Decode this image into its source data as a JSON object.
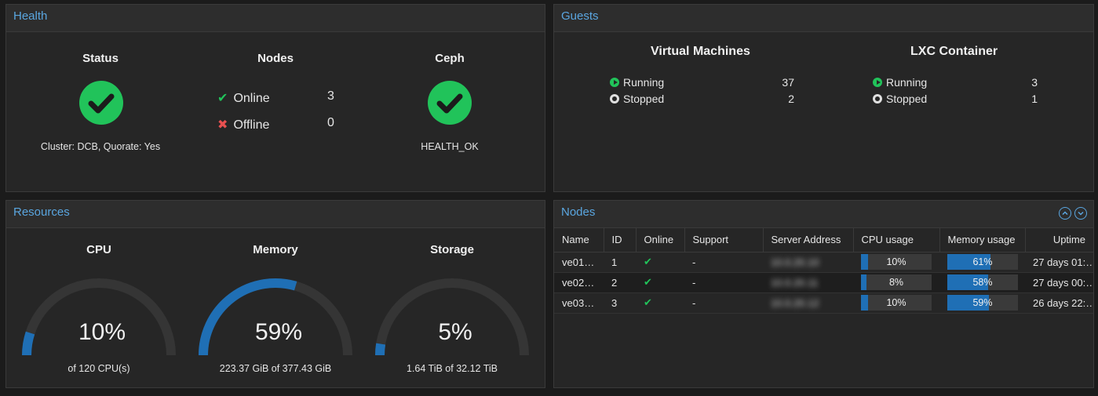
{
  "health": {
    "title": "Health",
    "status": {
      "title": "Status",
      "text": "Cluster: DCB, Quorate: Yes"
    },
    "nodes": {
      "title": "Nodes",
      "online_label": "Online",
      "online_count": "3",
      "offline_label": "Offline",
      "offline_count": "0"
    },
    "ceph": {
      "title": "Ceph",
      "text": "HEALTH_OK"
    }
  },
  "guests": {
    "title": "Guests",
    "vm": {
      "title": "Virtual Machines",
      "running_label": "Running",
      "running": "37",
      "stopped_label": "Stopped",
      "stopped": "2"
    },
    "lxc": {
      "title": "LXC Container",
      "running_label": "Running",
      "running": "3",
      "stopped_label": "Stopped",
      "stopped": "1"
    }
  },
  "resources": {
    "title": "Resources",
    "cpu": {
      "title": "CPU",
      "value": "10%",
      "fraction": 0.1,
      "sub": "of 120 CPU(s)"
    },
    "memory": {
      "title": "Memory",
      "value": "59%",
      "fraction": 0.59,
      "sub": "223.37 GiB of 377.43 GiB"
    },
    "storage": {
      "title": "Storage",
      "value": "5%",
      "fraction": 0.05,
      "sub": "1.64 TiB of 32.12 TiB"
    }
  },
  "nodes_panel": {
    "title": "Nodes",
    "columns": [
      "Name",
      "ID",
      "Online",
      "Support",
      "Server Address",
      "CPU usage",
      "Memory usage",
      "Uptime"
    ],
    "rows": [
      {
        "name": "ve01…",
        "id": "1",
        "support": "-",
        "address": "10.0.20.10",
        "cpu": "10%",
        "cpu_frac": 0.1,
        "mem": "61%",
        "mem_frac": 0.61,
        "uptime": "27 days 01:…"
      },
      {
        "name": "ve02…",
        "id": "2",
        "support": "-",
        "address": "10.0.20.11",
        "cpu": "8%",
        "cpu_frac": 0.08,
        "mem": "58%",
        "mem_frac": 0.58,
        "uptime": "27 days 00:…"
      },
      {
        "name": "ve03…",
        "id": "3",
        "support": "-",
        "address": "10.0.20.12",
        "cpu": "10%",
        "cpu_frac": 0.1,
        "mem": "59%",
        "mem_frac": 0.59,
        "uptime": "26 days 22:…"
      }
    ]
  },
  "colors": {
    "accent": "#5aa6e0",
    "ok": "#21c35a",
    "bad": "#e85050",
    "gauge_fill": "#1f6fb5",
    "gauge_track": "#353535"
  },
  "icons": [
    "check-circle-icon",
    "check-icon",
    "x-icon",
    "play-circle-icon",
    "stop-circle-icon",
    "collapse-up-icon",
    "expand-down-icon"
  ]
}
